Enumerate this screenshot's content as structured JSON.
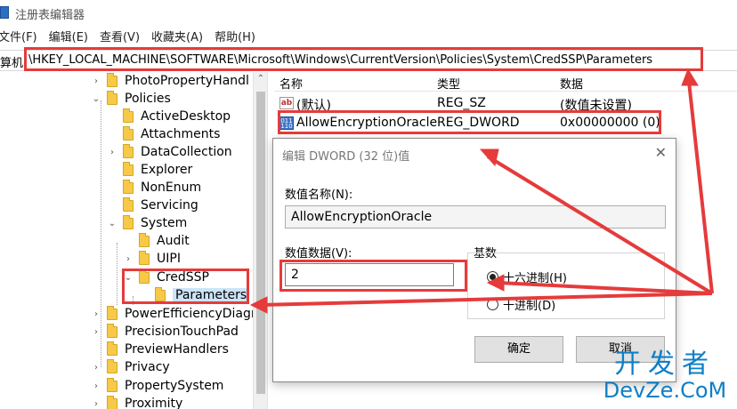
{
  "window": {
    "title": "注册表编辑器"
  },
  "menu": [
    "文件(F)",
    "编辑(E)",
    "查看(V)",
    "收藏夹(A)",
    "帮助(H)"
  ],
  "address": {
    "prefix": "算机",
    "path": "\\HKEY_LOCAL_MACHINE\\SOFTWARE\\Microsoft\\Windows\\CurrentVersion\\Policies\\System\\CredSSP\\Parameters"
  },
  "tree": [
    {
      "label": "PhotoPropertyHandl",
      "chevron": "›"
    },
    {
      "label": "Policies",
      "chevron": "⌄"
    },
    {
      "label": "ActiveDesktop",
      "chevron": ""
    },
    {
      "label": "Attachments",
      "chevron": ""
    },
    {
      "label": "DataCollection",
      "chevron": "›"
    },
    {
      "label": "Explorer",
      "chevron": ""
    },
    {
      "label": "NonEnum",
      "chevron": ""
    },
    {
      "label": "Servicing",
      "chevron": ""
    },
    {
      "label": "System",
      "chevron": "⌄"
    },
    {
      "label": "Audit",
      "chevron": ""
    },
    {
      "label": "UIPI",
      "chevron": "›"
    },
    {
      "label": "CredSSP",
      "chevron": "⌄"
    },
    {
      "label": "Parameters",
      "chevron": ""
    },
    {
      "label": "PowerEfficiencyDiagr",
      "chevron": "›"
    },
    {
      "label": "PrecisionTouchPad",
      "chevron": "›"
    },
    {
      "label": "PreviewHandlers",
      "chevron": ""
    },
    {
      "label": "Privacy",
      "chevron": "›"
    },
    {
      "label": "PropertySystem",
      "chevron": "›"
    },
    {
      "label": "Proximity",
      "chevron": "›"
    }
  ],
  "list": {
    "headers": {
      "name": "名称",
      "type": "类型",
      "data": "数据"
    },
    "rows": [
      {
        "name": "(默认)",
        "type": "REG_SZ",
        "data": "(数值未设置)",
        "icon": "ab-string-icon",
        "icon_text": "ab"
      },
      {
        "name": "AllowEncryptionOracle",
        "type": "REG_DWORD",
        "data": "0x00000000 (0)",
        "icon": "dword-value-icon",
        "icon_text": "011 110"
      }
    ]
  },
  "dialog": {
    "title": "编辑 DWORD (32 位)值",
    "close": "✕",
    "name_label": "数值名称(N):",
    "name_value": "AllowEncryptionOracle",
    "data_label": "数值数据(V):",
    "data_value": "2",
    "base_label": "基数",
    "radio_hex": "十六进制(H)",
    "radio_dec": "十进制(D)",
    "ok": "确定",
    "cancel": "取消"
  },
  "scroll_up": "⌃",
  "watermark": {
    "cn": "开发者",
    "en": "DevZe.CoM"
  },
  "colors": {
    "highlight_red": "#e53b3b",
    "selection": "#cce4f7",
    "watermark": "#0f7fc6"
  }
}
